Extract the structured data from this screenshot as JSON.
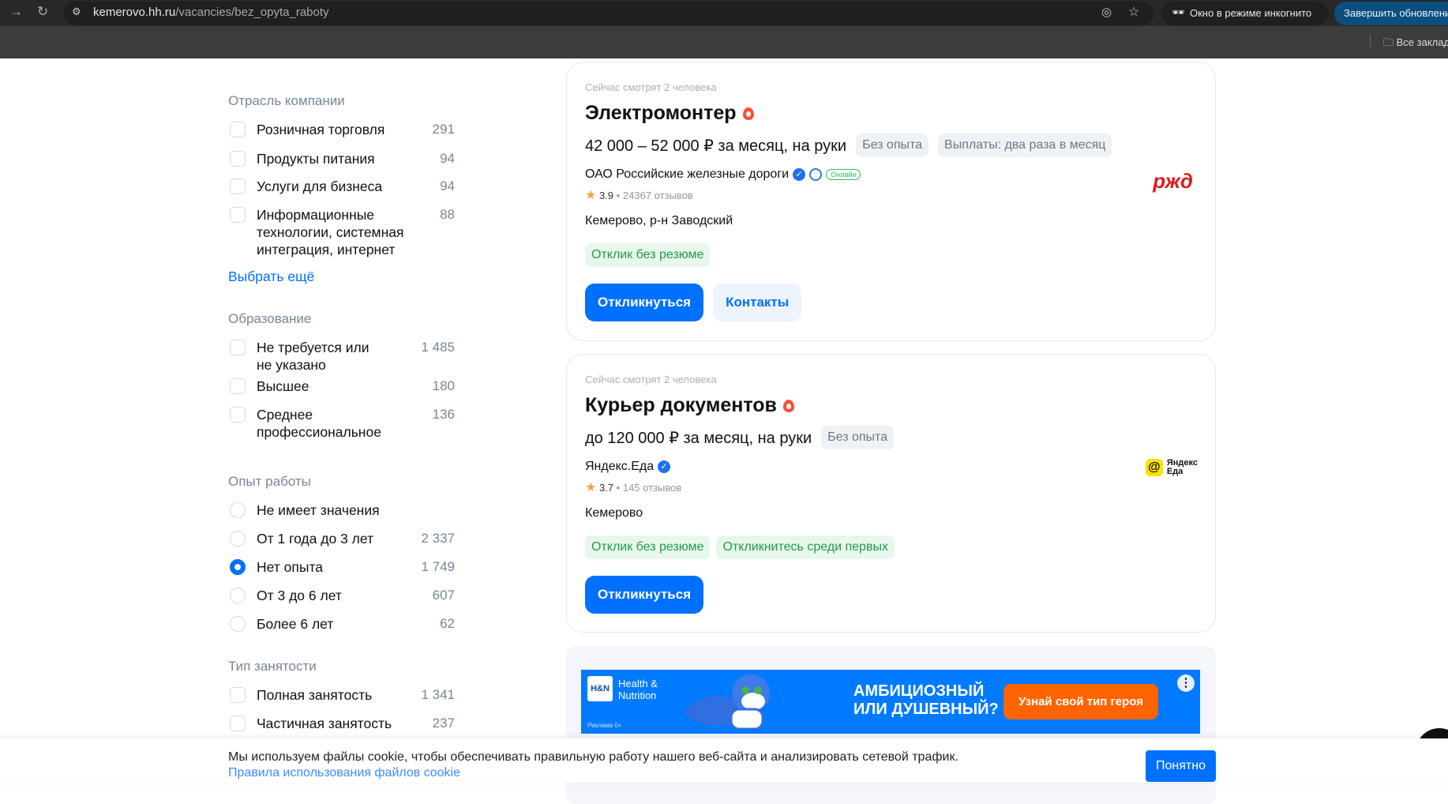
{
  "browser": {
    "url_host": "kemerovo.hh.ru",
    "url_path": "/vacancies/bez_opyta_raboty",
    "incognito": "Окно в режиме инкогнито",
    "update": "Завершить обновление",
    "bookmarks": "Все закладки"
  },
  "filters": [
    {
      "title": "Отрасль компании",
      "type": "checkbox",
      "items": [
        {
          "label": "Розничная торговля",
          "count": "291"
        },
        {
          "label": "Продукты питания",
          "count": "94"
        },
        {
          "label": "Услуги для бизнеса",
          "count": "94"
        },
        {
          "label": "Информационные технологии, системная интеграция, интернет",
          "count": "88"
        }
      ],
      "more": "Выбрать ещё"
    },
    {
      "title": "Образование",
      "type": "checkbox",
      "items": [
        {
          "label": "Не требуется или не указано",
          "count": "1 485"
        },
        {
          "label": "Высшее",
          "count": "180"
        },
        {
          "label": "Среднее профессиональное",
          "count": "136"
        }
      ]
    },
    {
      "title": "Опыт работы",
      "type": "radio",
      "items": [
        {
          "label": "Не имеет значения",
          "count": ""
        },
        {
          "label": "От 1 года до 3 лет",
          "count": "2 337"
        },
        {
          "label": "Нет опыта",
          "count": "1 749",
          "selected": true
        },
        {
          "label": "От 3 до 6 лет",
          "count": "607"
        },
        {
          "label": "Более 6 лет",
          "count": "62"
        }
      ]
    },
    {
      "title": "Тип занятости",
      "type": "checkbox",
      "items": [
        {
          "label": "Полная занятость",
          "count": "1 341"
        },
        {
          "label": "Частичная занятость",
          "count": "237"
        }
      ]
    }
  ],
  "vacancies": [
    {
      "watching": "Сейчас смотрят 2 человека",
      "title": "Электромонтер",
      "salary": "42 000 – 52 000 ₽ за месяц, на руки",
      "chips": [
        "Без опыта",
        "Выплаты: два раза в месяц"
      ],
      "company": "ОАО Российские железные дороги",
      "online": "Онлайн",
      "rating": "3.9",
      "reviews": "24367 отзывов",
      "city": "Кемерово, р-н Заводский",
      "tags": [
        "Отклик без резюме"
      ],
      "apply": "Откликнуться",
      "contacts": "Контакты",
      "logo": "РЖД"
    },
    {
      "watching": "Сейчас смотрят 2 человека",
      "title": "Курьер документов",
      "salary": "до 120 000 ₽ за месяц, на руки",
      "chips": [
        "Без опыта"
      ],
      "company": "Яндекс.Еда",
      "rating": "3.7",
      "reviews": "145 отзывов",
      "city": "Кемерово",
      "tags": [
        "Отклик без резюме",
        "Откликнитесь среди первых"
      ],
      "apply": "Откликнуться",
      "logo_line1": "Яндекс",
      "logo_line2": "Еда"
    }
  ],
  "ad": {
    "brand1": "Health &",
    "brand2": "Nutrition",
    "brand_logo": "H&N",
    "label": "Реклама 0+",
    "headline1": "АМБИЦИОЗНЫЙ",
    "headline2": "ИЛИ ДУШЕВНЫЙ?",
    "cta": "Узнай свой тип героя"
  },
  "cookie": {
    "text": "Мы используем файлы cookie, чтобы обеспечивать правильную работу нашего веб-сайта и анализировать сетевой трафик.",
    "link": "Правила использования файлов cookie",
    "ok": "Понятно"
  }
}
